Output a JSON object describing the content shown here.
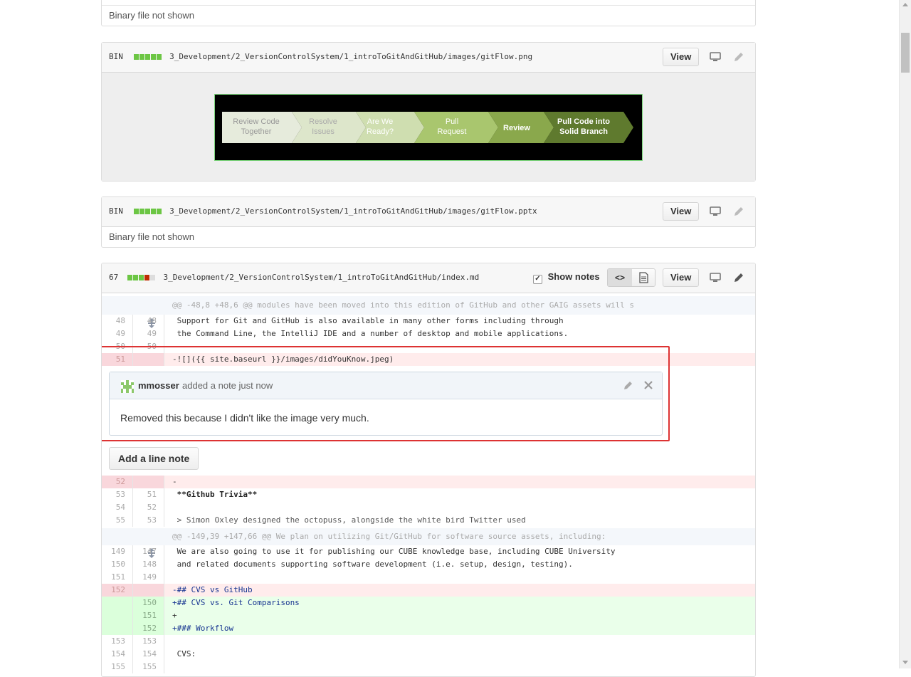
{
  "file0": {
    "message": "Binary file not shown"
  },
  "file1": {
    "type_label": "BIN",
    "path": "3_Development/2_VersionControlSystem/1_introToGitAndGitHub/images/gitFlow.png",
    "view_label": "View",
    "image_steps": [
      "Review Code Together",
      "Resolve Issues",
      "Are We Ready?",
      "Pull Request",
      "Review",
      "Pull Code into Solid Branch"
    ]
  },
  "file2": {
    "type_label": "BIN",
    "path": "3_Development/2_VersionControlSystem/1_introToGitAndGitHub/images/gitFlow.pptx",
    "view_label": "View",
    "message": "Binary file not shown"
  },
  "file3": {
    "changes": "67",
    "path": "3_Development/2_VersionControlSystem/1_introToGitAndGitHub/index.md",
    "show_notes_label": "Show notes",
    "show_notes_checked": true,
    "view_label": "View",
    "hunk1": "@@ -48,8 +48,6 @@ modules have been moved into this edition of GitHub and other GAIG assets will s",
    "rows_a": [
      {
        "o": "48",
        "n": "48",
        "code": " Support for Git and GitHub is also available in many other forms including through"
      },
      {
        "o": "49",
        "n": "49",
        "code": " the Command Line, the IntelliJ IDE and a number of desktop and mobile applications."
      },
      {
        "o": "50",
        "n": "50",
        "code": ""
      },
      {
        "o": "51",
        "n": "",
        "code": "-![]({{ site.baseurl }}/images/didYouKnow.jpeg)"
      }
    ],
    "note": {
      "author": "mmosser",
      "action": "added a note just now",
      "body": "Removed this because I didn't like the image very much."
    },
    "add_note_label": "Add a line note",
    "rows_b": [
      {
        "o": "52",
        "n": "",
        "code": "-"
      },
      {
        "o": "53",
        "n": "51",
        "code": " **Github Trivia**"
      },
      {
        "o": "54",
        "n": "52",
        "code": ""
      },
      {
        "o": "55",
        "n": "53",
        "code": " > Simon Oxley designed the octopuss, alongside the white bird Twitter used"
      }
    ],
    "hunk2": "@@ -149,39 +147,66 @@ We plan on utilizing Git/GitHub for software source assets, including:",
    "rows_c": [
      {
        "o": "149",
        "n": "147",
        "code": " We are also going to use it for publishing our CUBE knowledge base, including CUBE University"
      },
      {
        "o": "150",
        "n": "148",
        "code": " and related documents supporting software development (i.e. setup, design, testing)."
      },
      {
        "o": "151",
        "n": "149",
        "code": ""
      },
      {
        "o": "152",
        "n": "",
        "code": "-## CVS vs GitHub"
      },
      {
        "o": "",
        "n": "150",
        "code": "+## CVS vs. Git Comparisons"
      },
      {
        "o": "",
        "n": "151",
        "code": "+"
      },
      {
        "o": "",
        "n": "152",
        "code": "+### Workflow"
      },
      {
        "o": "153",
        "n": "153",
        "code": ""
      },
      {
        "o": "154",
        "n": "154",
        "code": " CVS:"
      },
      {
        "o": "155",
        "n": "155",
        "code": ""
      }
    ]
  }
}
